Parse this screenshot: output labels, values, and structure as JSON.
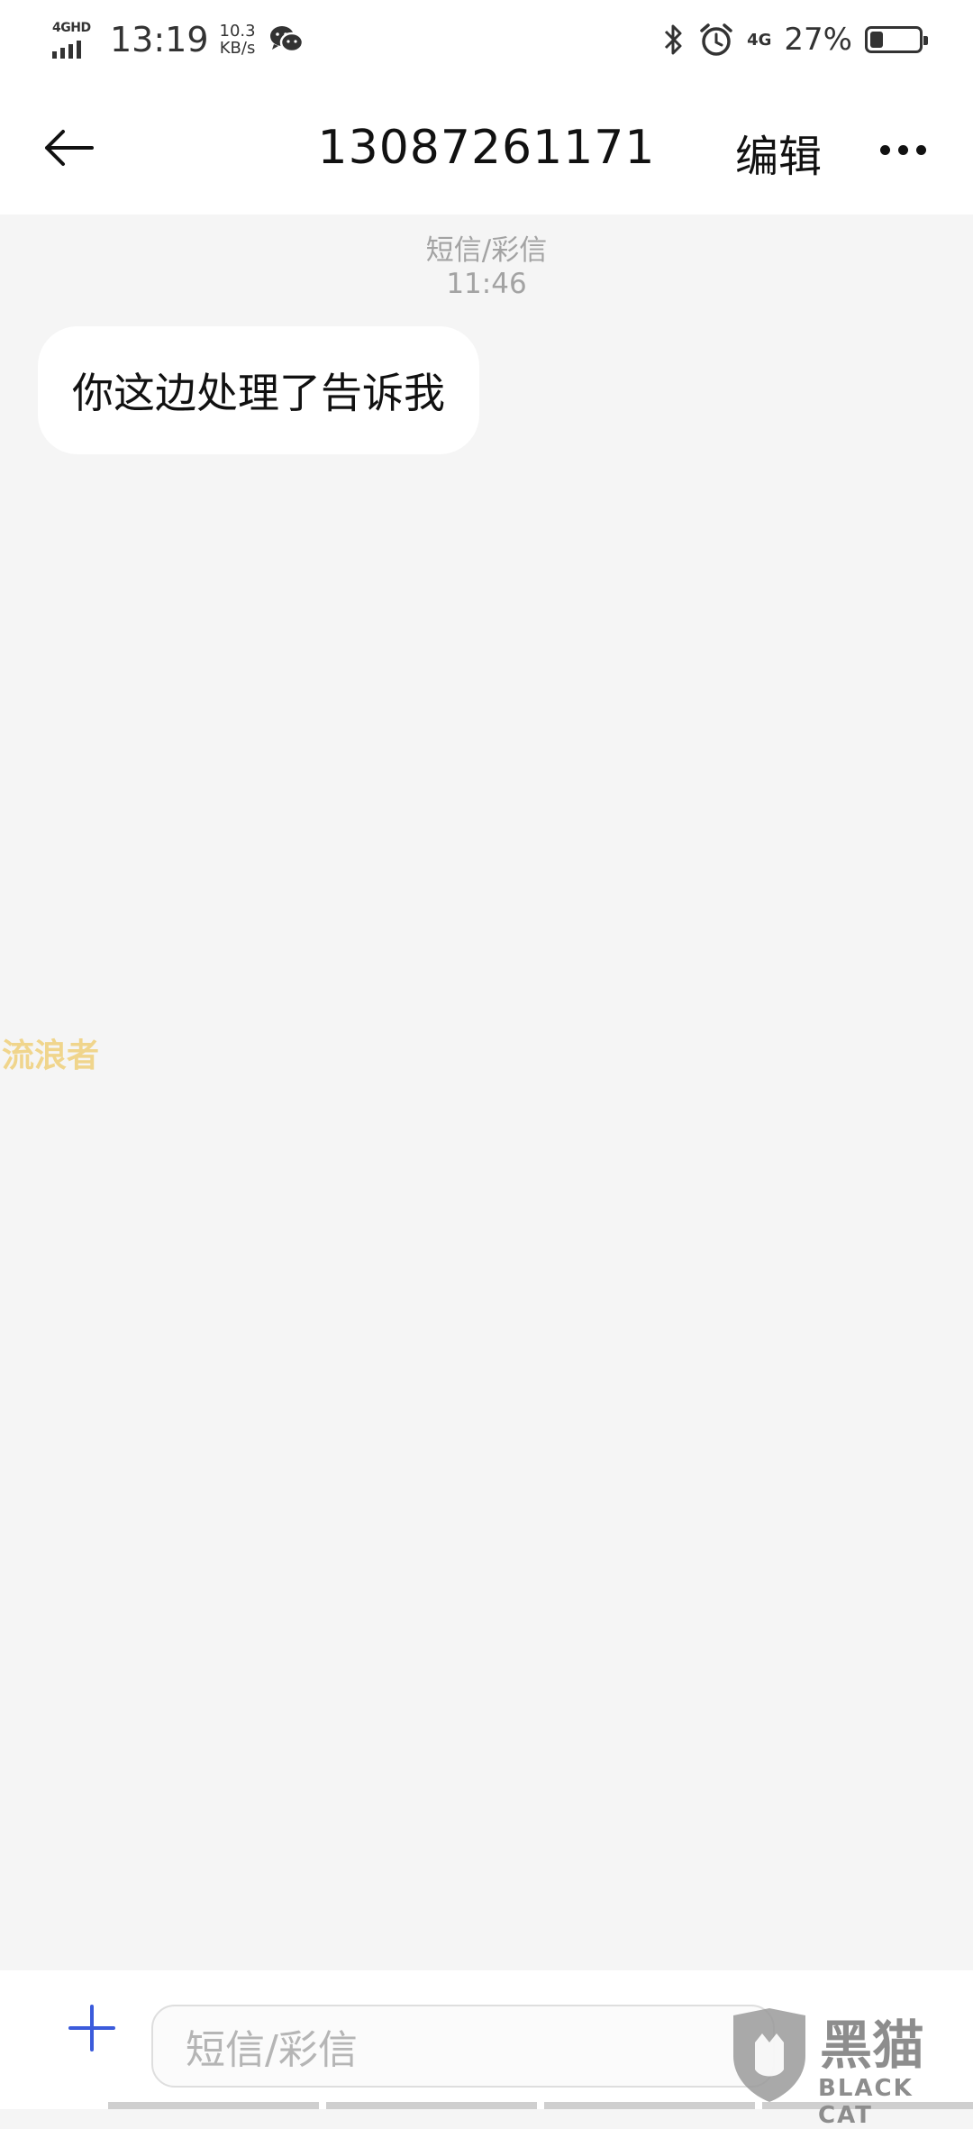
{
  "status_bar": {
    "network": "4GHD",
    "time": "13:19",
    "speed_value": "10.3",
    "speed_unit": "KB/s",
    "network2": "4G",
    "battery": "27%",
    "battery_level": 0.27,
    "icons": [
      "signal-icon",
      "wechat-icon",
      "bluetooth-icon",
      "alarm-icon",
      "battery-icon"
    ]
  },
  "header": {
    "title": "13087261171",
    "edit_label": "编辑",
    "icons": [
      "back-arrow-icon",
      "more-icon"
    ]
  },
  "conversation": {
    "channel": "短信/彩信",
    "time": "11:46",
    "messages": [
      {
        "direction": "incoming",
        "text": "你这边处理了告诉我"
      }
    ]
  },
  "watermark": "流浪者",
  "composer": {
    "placeholder": "短信/彩信",
    "icons": [
      "plus-icon"
    ]
  },
  "logo": {
    "text": "黑猫",
    "sub": "BLACK CAT"
  },
  "colors": {
    "accent": "#3b5bdb",
    "background": "#f5f5f5",
    "bubble": "#ffffff",
    "meta_text": "#a3a3a3"
  }
}
